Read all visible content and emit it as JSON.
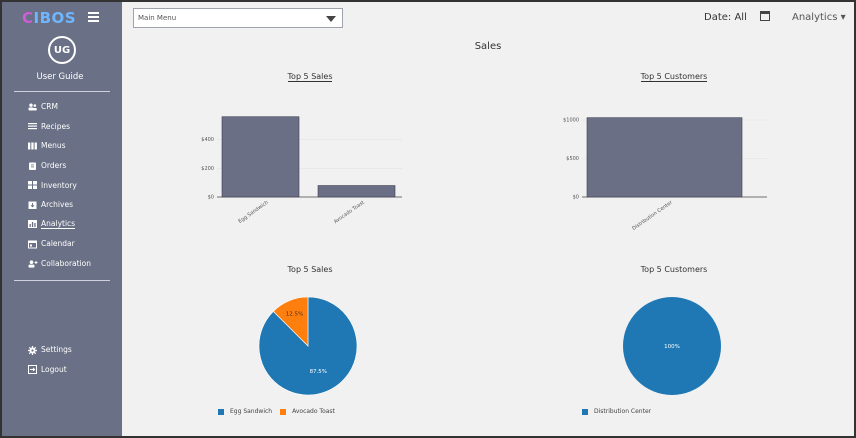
{
  "brand": {
    "logo_c": "C",
    "logo_rest": "IBOS"
  },
  "user": {
    "initials": "UG",
    "name": "User Guide"
  },
  "nav": [
    {
      "label": "CRM",
      "icon": "users-icon"
    },
    {
      "label": "Recipes",
      "icon": "list-icon"
    },
    {
      "label": "Menus",
      "icon": "columns-icon"
    },
    {
      "label": "Orders",
      "icon": "clipboard-icon"
    },
    {
      "label": "Inventory",
      "icon": "grid-icon"
    },
    {
      "label": "Archives",
      "icon": "archive-icon"
    },
    {
      "label": "Analytics",
      "icon": "bar-chart-icon",
      "active": true
    },
    {
      "label": "Calendar",
      "icon": "calendar-icon"
    },
    {
      "label": "Collaboration",
      "icon": "user-plus-icon"
    }
  ],
  "bottom_nav": [
    {
      "label": "Settings",
      "icon": "gear-icon"
    },
    {
      "label": "Logout",
      "icon": "logout-icon"
    }
  ],
  "topbar": {
    "main_menu": "Main Menu",
    "date_label": "Date: All",
    "analytics": "Analytics ▾"
  },
  "page_title": "Sales",
  "colors": {
    "bar": "#6b6f85",
    "pie_blue": "#1f78b4",
    "pie_orange": "#ff7f0e",
    "sidebar": "#6a7085"
  },
  "chart_data": [
    {
      "type": "bar",
      "title": "Top 5 Sales",
      "categories": [
        "Egg Sandwich",
        "Avocado Toast"
      ],
      "values": [
        560,
        80
      ],
      "ylim": [
        0,
        600
      ],
      "yticks": [
        0,
        200,
        400
      ],
      "ytick_labels": [
        "$0",
        "$200",
        "$400"
      ]
    },
    {
      "type": "bar",
      "title": "Top 5 Customers",
      "categories": [
        "Distribution Center"
      ],
      "values": [
        1030
      ],
      "ylim": [
        0,
        1000
      ],
      "yticks": [
        0,
        500,
        1000
      ],
      "ytick_labels": [
        "$0",
        "$500",
        "$1000"
      ]
    },
    {
      "type": "pie",
      "title": "Top 5 Sales",
      "labels": [
        "Egg Sandwich",
        "Avocado Toast"
      ],
      "values": [
        87.5,
        12.5
      ],
      "value_labels": [
        "87.5%",
        "12.5%"
      ],
      "legend": "bottom"
    },
    {
      "type": "pie",
      "title": "Top 5 Customers",
      "labels": [
        "Distribution Center"
      ],
      "values": [
        100
      ],
      "value_labels": [
        "100%"
      ],
      "legend": "bottom"
    }
  ]
}
